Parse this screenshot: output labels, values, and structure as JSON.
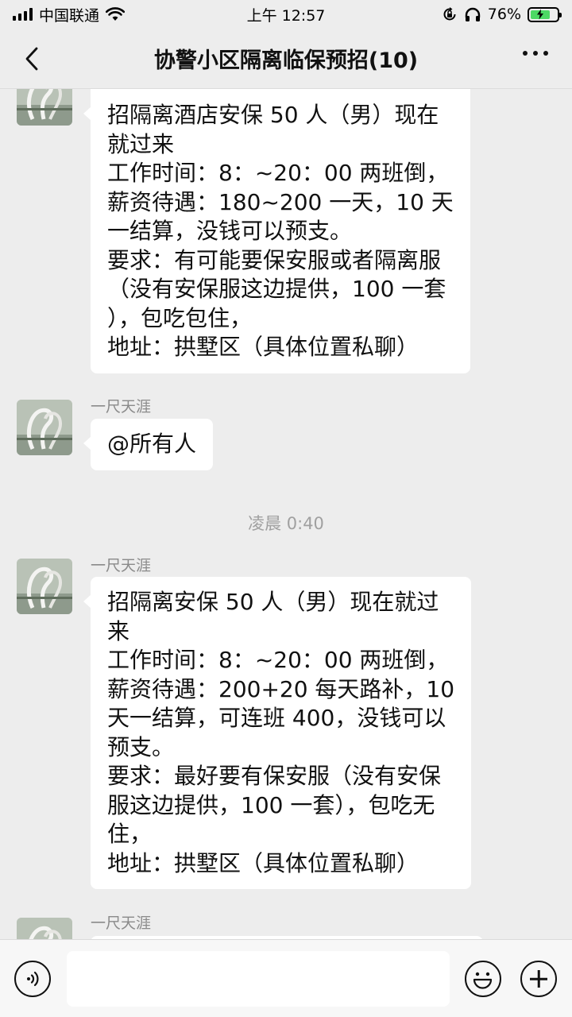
{
  "status_bar": {
    "carrier": "中国联通",
    "time": "上午 12:57",
    "battery_percent": "76%",
    "battery_level": 0.76
  },
  "header": {
    "title": "协警小区隔离临保预招(10)"
  },
  "messages": [
    {
      "sender": "",
      "lines": [
        "招隔离酒店安保 50 人（男）现在",
        "就过来",
        "工作时间：8：~20：00 两班倒，",
        "薪资待遇：180~200 一天，10 天",
        "一结算，没钱可以预支。",
        "要求：有可能要保安服或者隔离服",
        "（没有安保服这边提供，100 一套",
        "），包吃包住，",
        "地址：拱墅区（具体位置私聊）"
      ]
    },
    {
      "sender": "一尺天涯",
      "lines": [
        "@所有人"
      ]
    },
    {
      "sender": "一尺天涯",
      "lines": [
        "招隔离安保 50 人（男）现在就过",
        "来",
        "工作时间：8：~20：00 两班倒，",
        "薪资待遇：200+20 每天路补，10",
        "天一结算，可连班 400，没钱可以",
        "预支。",
        "要求：最好要有保安服（没有安保",
        "服这边提供，100 一套），包吃无",
        "住，",
        "地址：拱墅区（具体位置私聊）"
      ]
    },
    {
      "sender": "一尺天涯",
      "lines": []
    }
  ],
  "timestamp": "凌晨 0:40",
  "input": {
    "placeholder": ""
  },
  "colors": {
    "background": "#ededed",
    "bubble": "#ffffff",
    "battery": "#4cd964"
  }
}
